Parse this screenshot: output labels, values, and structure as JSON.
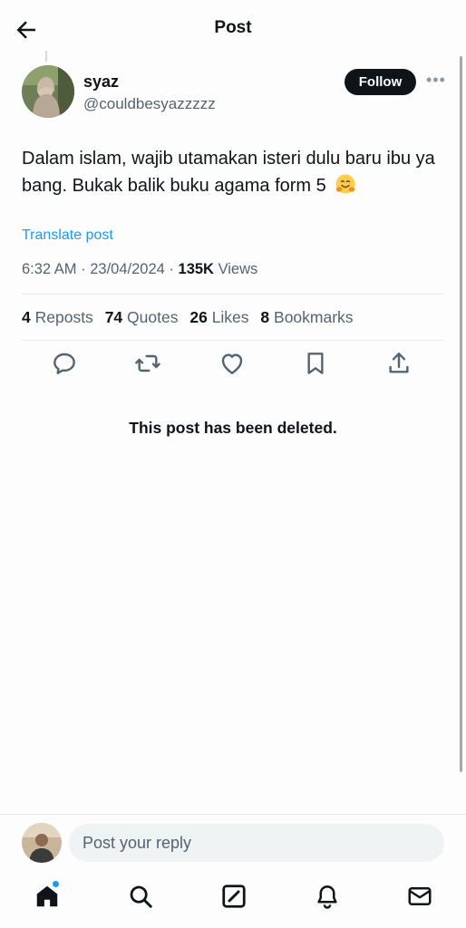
{
  "header": {
    "title": "Post"
  },
  "post": {
    "author_name": "syaz",
    "author_handle": "@couldbesyazzzzz",
    "follow_label": "Follow",
    "text": "Dalam islam, wajib utamakan isteri dulu baru ibu ya bang. Bukak balik buku agama form 5",
    "emoji_icon": "smiling-hugging-face-emoji",
    "translate_label": "Translate post",
    "time": "6:32 AM",
    "date": "23/04/2024",
    "views_count": "135K",
    "views_label": "Views",
    "stats": {
      "reposts_count": "4",
      "reposts_label": "Reposts",
      "quotes_count": "74",
      "quotes_label": "Quotes",
      "likes_count": "26",
      "likes_label": "Likes",
      "bookmarks_count": "8",
      "bookmarks_label": "Bookmarks"
    },
    "actions": [
      "reply-icon",
      "repost-icon",
      "like-icon",
      "bookmark-icon",
      "share-icon"
    ]
  },
  "deleted_notice": "This post has been deleted.",
  "reply": {
    "placeholder": "Post your reply"
  },
  "tabbar": {
    "items": [
      "home-icon",
      "search-icon",
      "grok-compose-icon",
      "notifications-icon",
      "messages-icon"
    ],
    "has_unread_dot": true
  },
  "colors": {
    "accent": "#1d9bf0",
    "text": "#0f1419",
    "muted": "#536471",
    "background": "#fdfdfe"
  }
}
